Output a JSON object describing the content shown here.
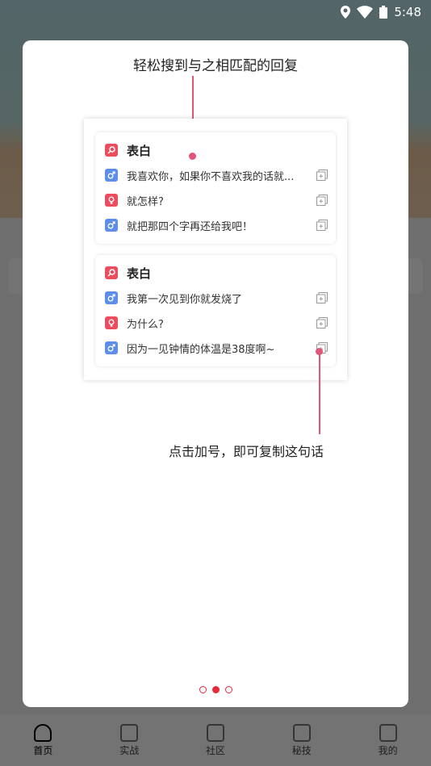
{
  "status_bar": {
    "time": "5:48"
  },
  "tab_bar": {
    "items": [
      {
        "label": "首页",
        "icon": "home-icon"
      },
      {
        "label": "实战",
        "icon": "document-icon"
      },
      {
        "label": "社区",
        "icon": "community-icon"
      },
      {
        "label": "秘技",
        "icon": "gift-icon"
      },
      {
        "label": "我的",
        "icon": "profile-icon"
      }
    ],
    "active_index": 0
  },
  "dialog": {
    "title": "轻松搜到与之相匹配的回复",
    "caption": "点击加号，即可复制这句话",
    "pager": {
      "count": 3,
      "active_index": 1
    },
    "accent_color": "#e25679",
    "groups": [
      {
        "heading": "表白",
        "lines": [
          {
            "speaker": "male",
            "text": "我喜欢你，如果你不喜欢我的话就..."
          },
          {
            "speaker": "female",
            "text": "就怎样?"
          },
          {
            "speaker": "male",
            "text": "就把那四个字再还给我吧！"
          }
        ]
      },
      {
        "heading": "表白",
        "lines": [
          {
            "speaker": "male",
            "text": "我第一次见到你就发烧了"
          },
          {
            "speaker": "female",
            "text": "为什么?"
          },
          {
            "speaker": "male",
            "text": "因为一见钟情的体温是38度啊~"
          }
        ]
      }
    ]
  },
  "colors": {
    "female_badge": "#ec4d5d",
    "male_badge": "#5d8ee8",
    "pager": "#e8293b"
  }
}
